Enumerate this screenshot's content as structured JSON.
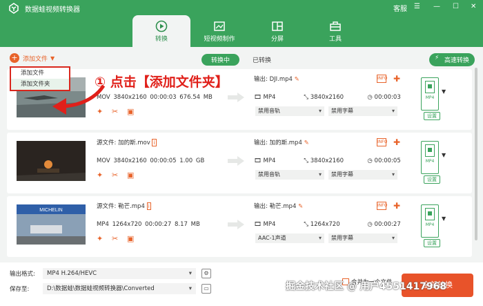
{
  "app": {
    "title": "数据蛙视频转换器",
    "support": "客服",
    "brand_color": "#3aa35c",
    "accent_color": "#e8632a"
  },
  "tabs": [
    {
      "label": "转换",
      "icon": "convert-icon",
      "active": true
    },
    {
      "label": "短视频制作",
      "icon": "film-icon",
      "active": false
    },
    {
      "label": "分屏",
      "icon": "split-screen-icon",
      "active": false
    },
    {
      "label": "工具",
      "icon": "toolbox-icon",
      "active": false
    }
  ],
  "toolbar": {
    "add_file": "添加文件",
    "converting": "转换中",
    "converted": "已转换",
    "fast_convert": "高速转换"
  },
  "dropdown": {
    "items": [
      "添加文件",
      "添加文件夹"
    ]
  },
  "annotation": "① 点击【添加文件夹】",
  "files": [
    {
      "source": "",
      "meta": "MOV  3840x2160  00:00:03  676.54 MB",
      "output": "输出: DJI.mp4",
      "out_format": "MP4",
      "out_res": "3840x2160",
      "out_time": "00:00:03",
      "audio": "禁用音轨",
      "subtitle": "禁用字幕",
      "fmt": "MP4",
      "settings": "设置"
    },
    {
      "source": "源文件: 加的斯.mov",
      "meta": "MOV  3840x2160  00:00:05  1.00 GB",
      "output": "输出: 加的斯.mp4",
      "out_format": "MP4",
      "out_res": "3840x2160",
      "out_time": "00:00:05",
      "audio": "禁用音轨",
      "subtitle": "禁用字幕",
      "fmt": "MP4",
      "settings": "设置"
    },
    {
      "source": "源文件: 勒芒.mp4",
      "meta": "MP4  1264x720  00:00:27  8.17 MB",
      "output": "输出: 勒芒.mp4",
      "out_format": "MP4",
      "out_res": "1264x720",
      "out_time": "00:00:27",
      "audio": "AAC-1声道",
      "subtitle": "禁用字幕",
      "fmt": "MP4",
      "settings": "设置"
    }
  ],
  "bottom": {
    "output_format_label": "输出格式:",
    "output_format_value": "MP4 H.264/HEVC",
    "save_to_label": "保存至:",
    "save_to_value": "D:\\数据蛙\\数据蛙视频转换器\\Converted",
    "merge_label": "合并为一个文件",
    "convert_all": "全部转换"
  },
  "watermark": "掘金技术社区 @ 用户4551417968"
}
